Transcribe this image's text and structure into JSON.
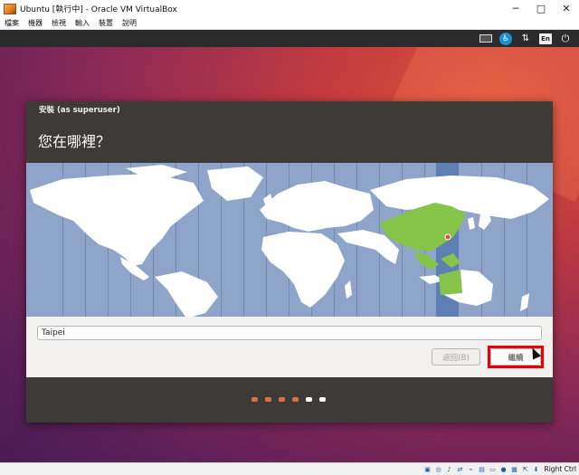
{
  "window": {
    "title": "Ubuntu [執行中] - Oracle VM VirtualBox",
    "controls": {
      "minimize": "─",
      "maximize": "□",
      "close": "✕"
    }
  },
  "menubar": {
    "items": [
      "檔案",
      "機器",
      "檢視",
      "輸入",
      "裝置",
      "說明"
    ]
  },
  "toolbar": {
    "language_badge": "En",
    "icons": [
      "keyboard-icon",
      "accessibility-icon",
      "network-arrows-icon",
      "language-badge",
      "power-icon"
    ]
  },
  "dialog": {
    "title": "安裝 (as superuser)",
    "heading": "您在哪裡？",
    "location_value": "Taipei",
    "back_label": "返回(B)",
    "continue_label": "繼續"
  },
  "progress": {
    "total_steps": 6,
    "completed_steps": 4,
    "completed_color": "#e07040",
    "pending_color": "#ffffff"
  },
  "map": {
    "ocean_color": "#8ea4c8",
    "land_color": "#ffffff",
    "highlight_color": "#86c449",
    "timezone_band_color": "#5d7fb4",
    "selected_city": "Taipei"
  },
  "statusbar": {
    "host_key": "Right Ctrl"
  },
  "colors": {
    "dialog_bg": "#3c3b37",
    "form_bg": "#f2f1f0",
    "highlight_box": "#e8000b"
  }
}
